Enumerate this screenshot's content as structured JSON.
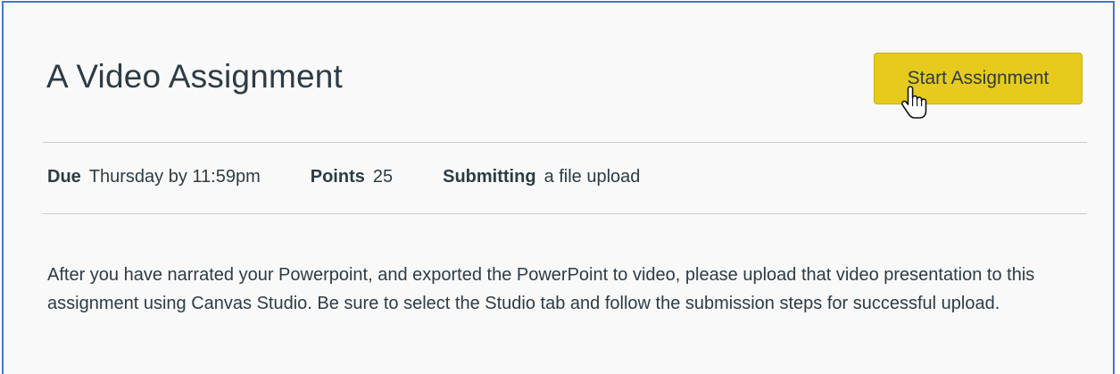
{
  "assignment": {
    "title": "A Video Assignment",
    "start_button_label": "Start Assignment",
    "details": {
      "due_label": "Due",
      "due_value": "Thursday by 11:59pm",
      "points_label": "Points",
      "points_value": "25",
      "submitting_label": "Submitting",
      "submitting_value": "a file upload"
    },
    "description": "After you have narrated your Powerpoint, and exported the PowerPoint to video, please upload that video presentation to this assignment using Canvas Studio.  Be sure to select the Studio tab and follow the submission steps for successful upload."
  },
  "colors": {
    "button_bg": "#e6cb1c",
    "frame_border": "#4a76c9",
    "text": "#2d3b45"
  },
  "icons": {
    "cursor": "hand-pointer-icon"
  }
}
